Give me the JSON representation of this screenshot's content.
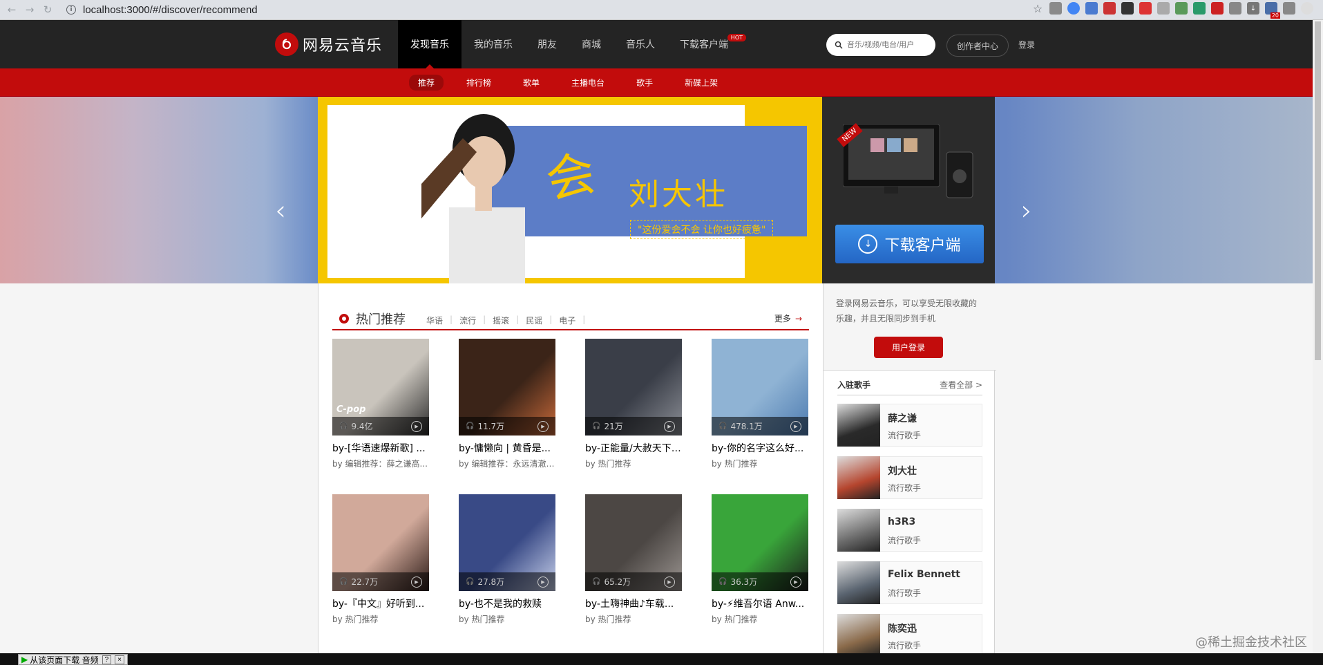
{
  "browser": {
    "url": "localhost:3000/#/discover/recommend",
    "ext_badge": "20"
  },
  "header": {
    "logo_text": "网易云音乐",
    "nav": [
      {
        "label": "发现音乐",
        "active": true
      },
      {
        "label": "我的音乐"
      },
      {
        "label": "朋友"
      },
      {
        "label": "商城"
      },
      {
        "label": "音乐人"
      },
      {
        "label": "下载客户端",
        "badge": "HOT"
      }
    ],
    "search_placeholder": "音乐/视频/电台/用户",
    "creator_label": "创作者中心",
    "login_label": "登录"
  },
  "subnav": [
    "推荐",
    "排行榜",
    "歌单",
    "主播电台",
    "歌手",
    "新碟上架"
  ],
  "banner": {
    "title": "刘大壮",
    "subtitle": "\"这份爱会不会 让你也好疲惫\"",
    "script": "会",
    "download_label": "下载客户端",
    "new_label": "NEW"
  },
  "hot": {
    "title": "热门推荐",
    "tags": [
      "华语",
      "流行",
      "摇滚",
      "民谣",
      "电子"
    ],
    "more": "更多"
  },
  "playlists": [
    {
      "count": "9.4亿",
      "title": "by-[华语速爆新歌] ...",
      "sub": "by 编辑推荐：薛之谦高...",
      "cover": "#c9c4bc",
      "cover2": "#2a2a2a",
      "cover_text": "C-pop"
    },
    {
      "count": "11.7万",
      "title": "by-慵懒向 | 黄昏是...",
      "sub": "by 编辑推荐：永远清澈 ...",
      "cover": "#3b2418",
      "cover2": "#c96a3a"
    },
    {
      "count": "21万",
      "title": "by-正能量/大赦天下/...",
      "sub": "by 热门推荐",
      "cover": "#3a3e48",
      "cover2": "#8c8f96"
    },
    {
      "count": "478.1万",
      "title": "by-你的名字这么好...",
      "sub": "by 热门推荐",
      "cover": "#8fb3d4",
      "cover2": "#4d7bb0"
    },
    {
      "count": "22.7万",
      "title": "by-『中文』好听到...",
      "sub": "by 热门推荐",
      "cover": "#d1a99a",
      "cover2": "#2b1a16"
    },
    {
      "count": "27.8万",
      "title": "by-也不是我的救赎",
      "sub": "by 热门推荐",
      "cover": "#394a86",
      "cover2": "#c7d0ea"
    },
    {
      "count": "65.2万",
      "title": "by-土嗨神曲♪车载...",
      "sub": "by 热门推荐",
      "cover": "#4c4744",
      "cover2": "#9b9591"
    },
    {
      "count": "36.3万",
      "title": "by-⚡维吾尔语 Anw...",
      "sub": "by 热门推荐",
      "cover": "#39a53a",
      "cover2": "#1b1b1b"
    }
  ],
  "login_panel": {
    "note": "登录网易云音乐，可以享受无限收藏的乐趣，并且无限同步到手机",
    "button": "用户登录"
  },
  "singers": {
    "title": "入驻歌手",
    "all": "查看全部 >",
    "items": [
      {
        "name": "薛之谦",
        "tag": "流行歌手",
        "color": "#2a2a2a"
      },
      {
        "name": "刘大壮",
        "tag": "流行歌手",
        "color": "#b5452e"
      },
      {
        "name": "h3R3",
        "tag": "流行歌手",
        "color": "#6a6a6a"
      },
      {
        "name": "Felix Bennett",
        "tag": "流行歌手",
        "color": "#5a6470"
      },
      {
        "name": "陈奕迅",
        "tag": "流行歌手",
        "color": "#8a6a4a"
      }
    ]
  },
  "watermark": "@稀土掘金技术社区",
  "download_tool": "从该页面下载 音频"
}
